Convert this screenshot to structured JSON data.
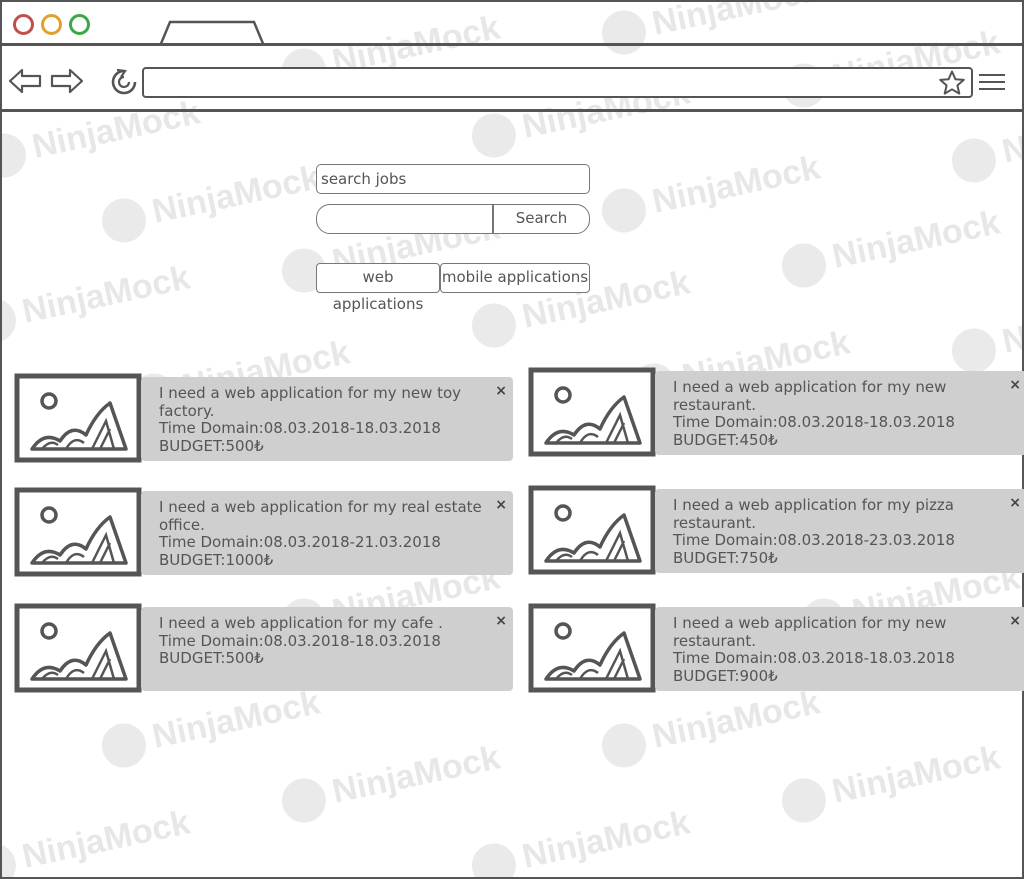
{
  "search": {
    "value": "search jobs",
    "button_label": "Search"
  },
  "categories": [
    "web applications",
    "mobile applications"
  ],
  "jobs": [
    {
      "line1": "I need a web application for my new toy",
      "line2": "factory.",
      "time": "Time Domain:08.03.2018-18.03.2018",
      "budget": "BUDGET:500₺"
    },
    {
      "line1": "I need a web application for my new",
      "line2": "restaurant.",
      "time": "Time Domain:08.03.2018-18.03.2018",
      "budget": "BUDGET:450₺"
    },
    {
      "line1": "I need a web application for my real estate",
      "line2": "office.",
      "time": "Time Domain:08.03.2018-21.03.2018",
      "budget": "BUDGET:1000₺"
    },
    {
      "line1": "I need a web application for my pizza",
      "line2": "restaurant.",
      "time": "Time Domain:08.03.2018-23.03.2018",
      "budget": "BUDGET:750₺"
    },
    {
      "line1": "I need a web application for my cafe .",
      "line2": "",
      "time": "Time Domain:08.03.2018-18.03.2018",
      "budget": "BUDGET:500₺"
    },
    {
      "line1": "I need a web application for my new",
      "line2": "restaurant.",
      "time": "Time Domain:08.03.2018-18.03.2018",
      "budget": "BUDGET:900₺"
    }
  ],
  "close_symbol": "×",
  "watermark": "NinjaMock",
  "colors": {
    "close_red": "#c0504d",
    "minimize_orange": "#e0a030",
    "maximize_green": "#3aa843",
    "card_bg": "#cfcfcf",
    "outline": "#555555"
  },
  "icons": [
    "back-arrow-icon",
    "forward-arrow-icon",
    "reload-icon",
    "star-icon",
    "menu-icon",
    "image-placeholder-icon",
    "close-icon"
  ]
}
